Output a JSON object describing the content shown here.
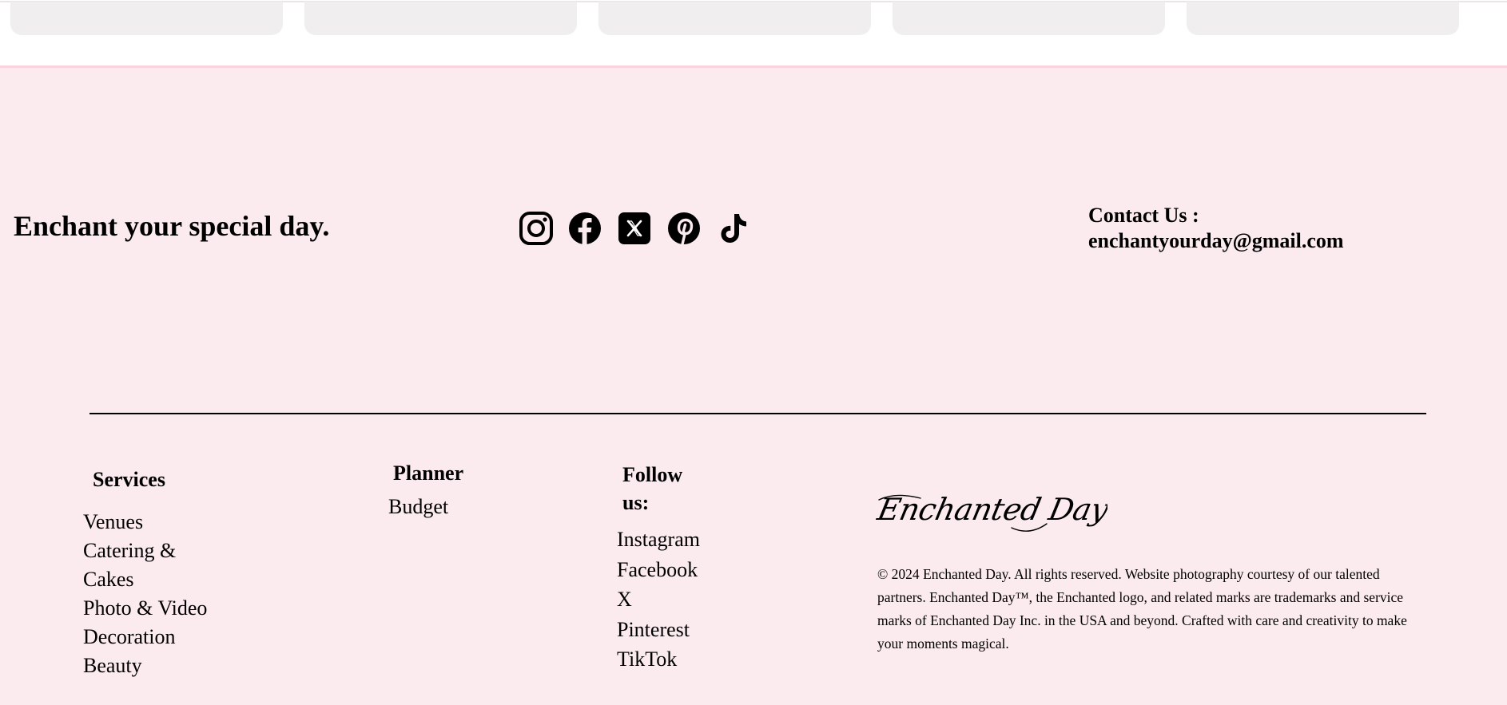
{
  "footer": {
    "tagline": "Enchant your special day.",
    "contact": {
      "label": "Contact Us :",
      "email": "enchantyourday@gmail.com"
    },
    "social_icons": [
      "instagram-icon",
      "facebook-icon",
      "x-icon",
      "pinterest-icon",
      "tiktok-icon"
    ],
    "services": {
      "heading": "Services",
      "items": [
        "Venues",
        "Catering & Cakes",
        "Photo & Video",
        "Decoration",
        "Beauty"
      ]
    },
    "planner": {
      "heading": "Planner",
      "items": [
        "Budget"
      ]
    },
    "follow": {
      "heading": "Follow us:",
      "items": [
        "Instagram",
        "Facebook",
        "X",
        "Pinterest",
        "TikTok"
      ]
    },
    "logo_text": "Enchanted Day",
    "legal": "© 2024 Enchanted Day. All rights reserved. Website photography courtesy of our talented partners. Enchanted Day™, the Enchanted logo, and related marks are trademarks and service marks of Enchanted Day Inc. in the USA and beyond. Crafted with care and creativity to make your moments magical."
  },
  "colors": {
    "footer_bg": "#fbebee",
    "footer_border": "#fbd3dc",
    "card_bg": "#f1eeef"
  }
}
